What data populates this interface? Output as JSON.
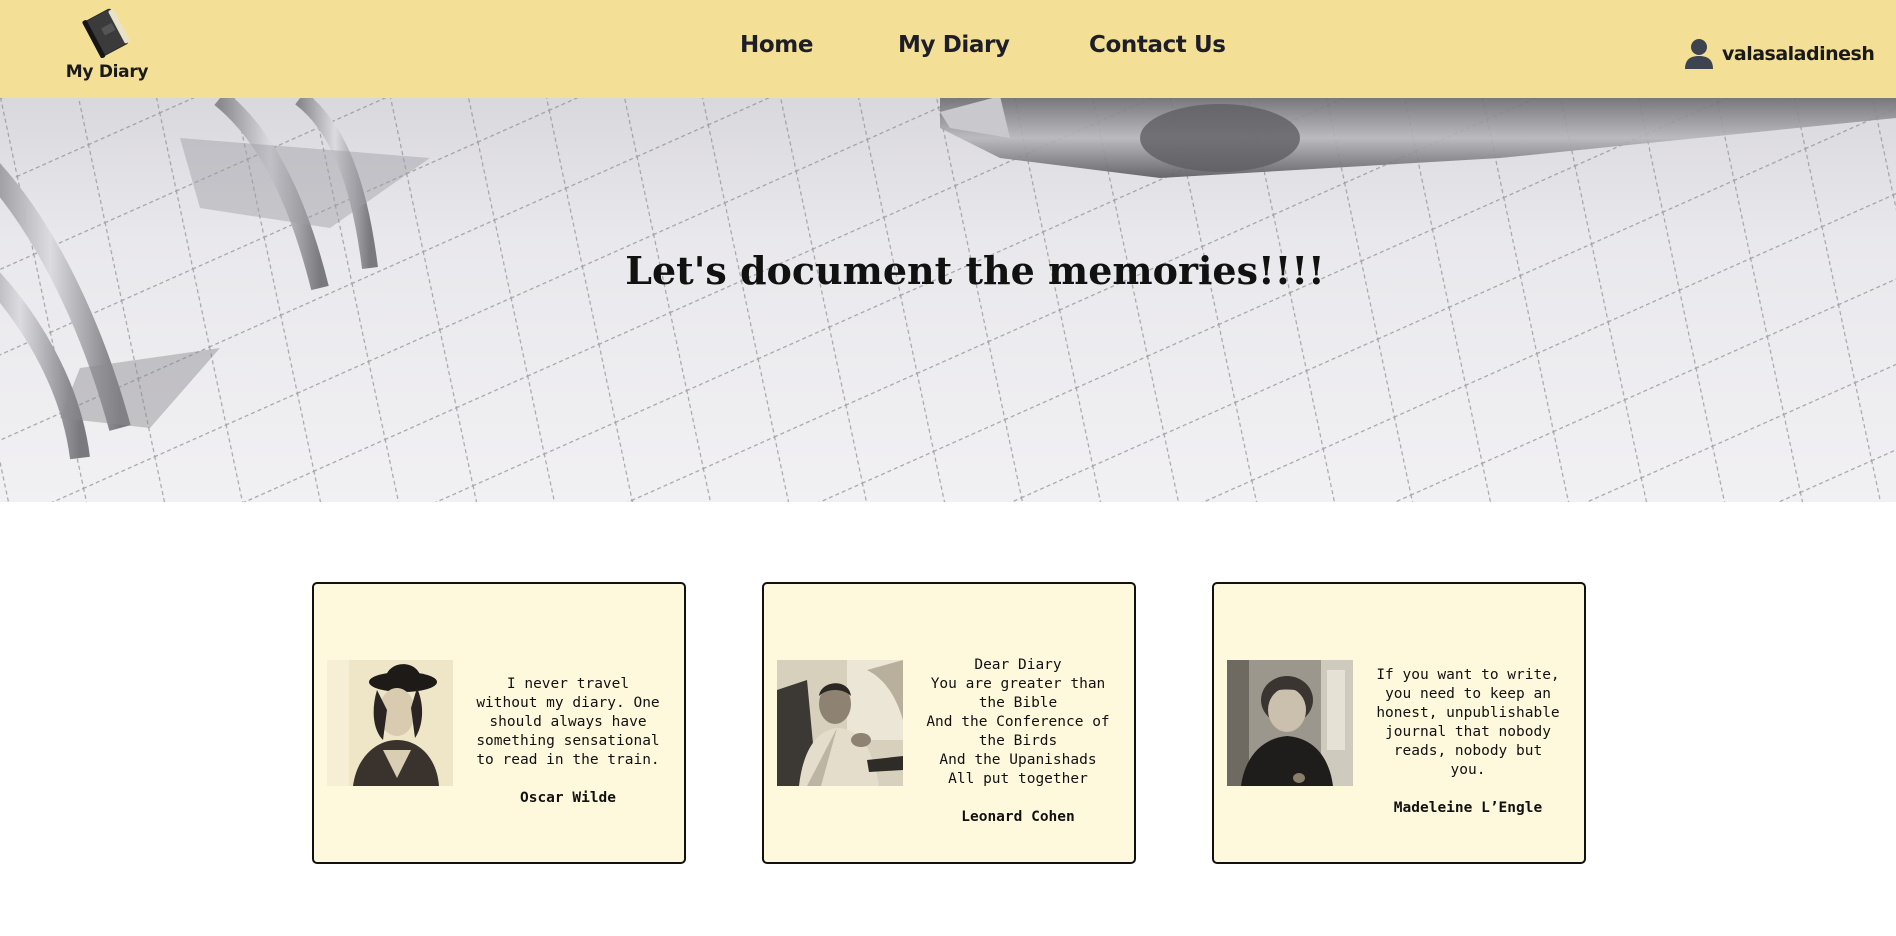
{
  "navbar": {
    "brand_label": "My Diary",
    "links": [
      {
        "label": "Home"
      },
      {
        "label": "My Diary"
      },
      {
        "label": "Contact Us"
      }
    ],
    "username": "valasaladinesh",
    "background_color": "#f3e096"
  },
  "hero": {
    "title": "Let's document the memories!!!!"
  },
  "quotes": [
    {
      "text": "I never travel\nwithout my diary. One\nshould always have\nsomething sensational\nto read in the train.",
      "author": "Oscar Wilde"
    },
    {
      "text": "Dear Diary\nYou are greater than\nthe Bible\nAnd the Conference of\nthe Birds\nAnd the Upanishads\nAll put together",
      "author": "Leonard Cohen"
    },
    {
      "text": "If you want to write,\nyou need to keep an\nhonest, unpublishable\njournal that nobody\nreads, nobody but\nyou.",
      "author": "Madeleine L’Engle"
    }
  ],
  "card_background_color": "#fef8dd"
}
